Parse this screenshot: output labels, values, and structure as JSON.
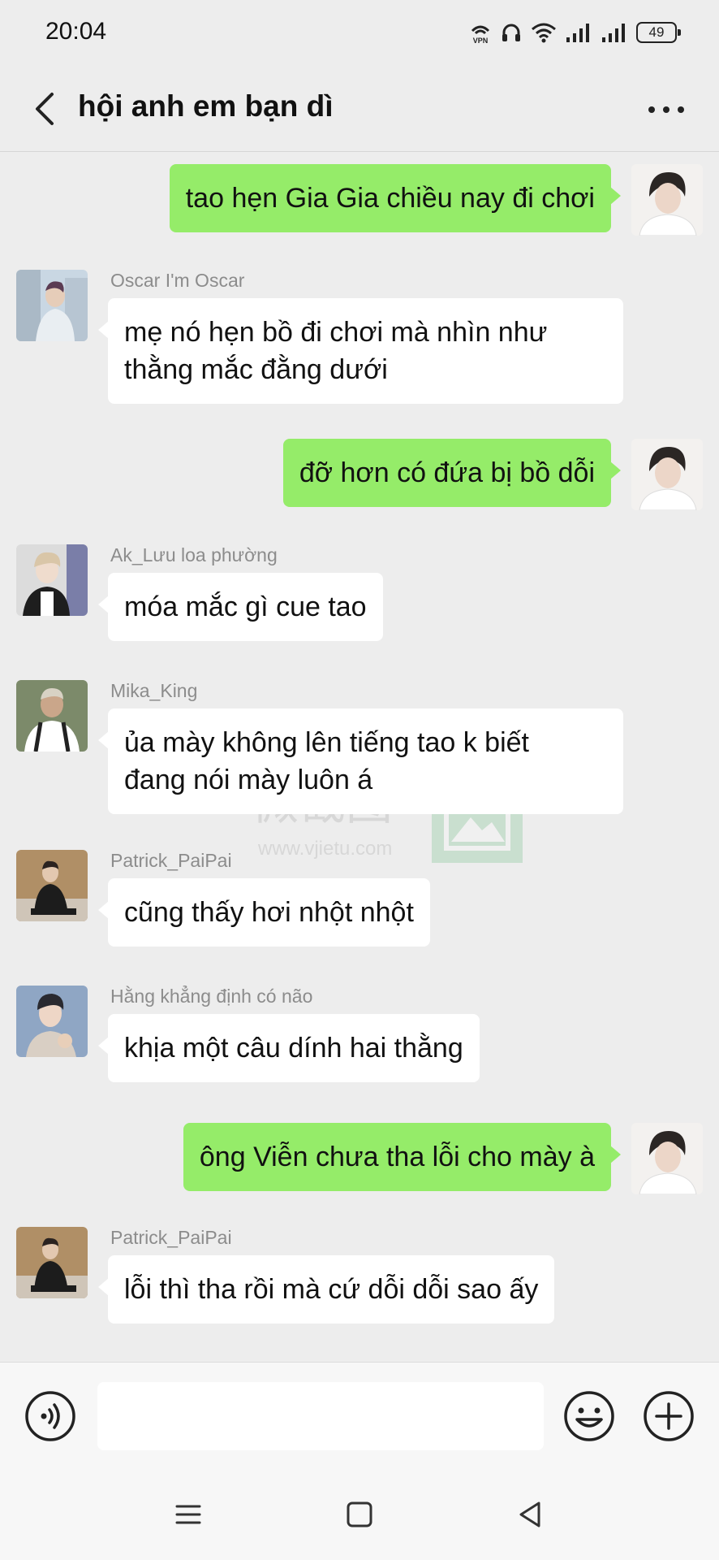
{
  "status_bar": {
    "time": "20:04",
    "battery": "49",
    "icons": [
      "vpn-icon",
      "headphones-icon",
      "wifi-icon",
      "signal-icon",
      "signal-icon",
      "battery-icon"
    ]
  },
  "header": {
    "title": "hội anh em bạn dì",
    "back_icon": "chevron-left-icon",
    "more_icon": "more-dots-icon"
  },
  "messages": [
    {
      "direction": "out",
      "text": "tao hẹn Gia Gia chiều nay đi chơi"
    },
    {
      "direction": "in",
      "sender": "Oscar I'm Oscar",
      "text_lines": [
        "mẹ nó hẹn bồ đi chơi mà nhìn như",
        "thằng mắc đằng dưới"
      ]
    },
    {
      "direction": "out",
      "text": "đỡ hơn có đứa bị bồ dỗi"
    },
    {
      "direction": "in",
      "sender": "Ak_Lưu loa phường",
      "text": "móa mắc gì cue tao"
    },
    {
      "direction": "in",
      "sender": "Mika_King",
      "text_lines": [
        "ủa mày không lên tiếng tao k biết",
        "đang nói mày luôn á"
      ]
    },
    {
      "direction": "in",
      "sender": "Patrick_PaiPai",
      "text": "cũng thấy hơi nhột nhột"
    },
    {
      "direction": "in",
      "sender": "Hằng khẳng định có não",
      "text": "khịa một câu dính hai thằng"
    },
    {
      "direction": "out",
      "text": "ông Viễn chưa tha lỗi cho mày à"
    },
    {
      "direction": "in",
      "sender": "Patrick_PaiPai",
      "text": "lỗi thì tha rồi mà cứ dỗi dỗi sao ấy"
    }
  ],
  "watermark": {
    "text": "微截图",
    "url": "www.vjietu.com"
  },
  "input_bar": {
    "voice_icon": "voice-icon",
    "input_value": "",
    "emoji_icon": "emoji-icon",
    "plus_icon": "plus-icon"
  },
  "nav_bar": {
    "icons": [
      "menu-icon",
      "home-icon",
      "back-icon"
    ]
  },
  "colors": {
    "background": "#ededed",
    "outgoing_bubble": "#95ec69",
    "incoming_bubble": "#ffffff",
    "sender_name": "#8c8c8c"
  }
}
